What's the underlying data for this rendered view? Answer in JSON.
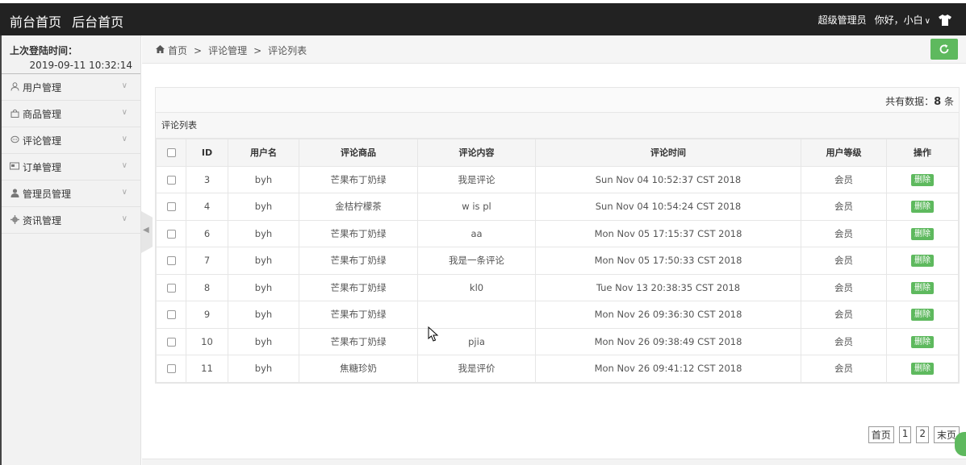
{
  "topbar": {
    "front_home": "前台首页",
    "back_home": "后台首页",
    "role": "超级管理员",
    "greeting": "你好，小白",
    "chevron": "∨"
  },
  "sidebar": {
    "last_login_label": "上次登陆时间：",
    "last_login_value": "2019-09-11 10:32:14",
    "items": [
      {
        "label": "用户管理",
        "icon": "user-icon"
      },
      {
        "label": "商品管理",
        "icon": "bag-icon"
      },
      {
        "label": "评论管理",
        "icon": "comment-icon"
      },
      {
        "label": "订单管理",
        "icon": "card-icon"
      },
      {
        "label": "管理员管理",
        "icon": "admin-icon"
      },
      {
        "label": "资讯管理",
        "icon": "gear-icon"
      }
    ]
  },
  "breadcrumb": {
    "home": "首页",
    "sep": ">",
    "section": "评论管理",
    "page": "评论列表"
  },
  "panel": {
    "total_label": "共有数据：",
    "total_count": "8",
    "total_unit": "条",
    "caption": "评论列表",
    "headers": [
      "ID",
      "用户名",
      "评论商品",
      "评论内容",
      "评论时间",
      "用户等级",
      "操作"
    ],
    "rows": [
      {
        "id": "3",
        "user": "byh",
        "product": "芒果布丁奶绿",
        "content": "我是评论",
        "time": "Sun Nov 04 10:52:37 CST 2018",
        "level": "会员",
        "action": "删除"
      },
      {
        "id": "4",
        "user": "byh",
        "product": "金桔柠檬茶",
        "content": "w is pl",
        "time": "Sun Nov 04 10:54:24 CST 2018",
        "level": "会员",
        "action": "删除"
      },
      {
        "id": "6",
        "user": "byh",
        "product": "芒果布丁奶绿",
        "content": "aa",
        "time": "Mon Nov 05 17:15:37 CST 2018",
        "level": "会员",
        "action": "删除"
      },
      {
        "id": "7",
        "user": "byh",
        "product": "芒果布丁奶绿",
        "content": "我是一条评论",
        "time": "Mon Nov 05 17:50:33 CST 2018",
        "level": "会员",
        "action": "删除"
      },
      {
        "id": "8",
        "user": "byh",
        "product": "芒果布丁奶绿",
        "content": "kl0",
        "time": "Tue Nov 13 20:38:35 CST 2018",
        "level": "会员",
        "action": "删除"
      },
      {
        "id": "9",
        "user": "byh",
        "product": "芒果布丁奶绿",
        "content": "",
        "time": "Mon Nov 26 09:36:30 CST 2018",
        "level": "会员",
        "action": "删除"
      },
      {
        "id": "10",
        "user": "byh",
        "product": "芒果布丁奶绿",
        "content": "pjia",
        "time": "Mon Nov 26 09:38:49 CST 2018",
        "level": "会员",
        "action": "删除"
      },
      {
        "id": "11",
        "user": "byh",
        "product": "焦糖珍奶",
        "content": "我是评价",
        "time": "Mon Nov 26 09:41:12 CST 2018",
        "level": "会员",
        "action": "删除"
      }
    ]
  },
  "pager": {
    "first": "首页",
    "p1": "1",
    "p2": "2",
    "last": "末页"
  },
  "colors": {
    "topbar": "#222222",
    "accent_green": "#5eb95e",
    "sidebar_bg": "#f2f2f2"
  }
}
